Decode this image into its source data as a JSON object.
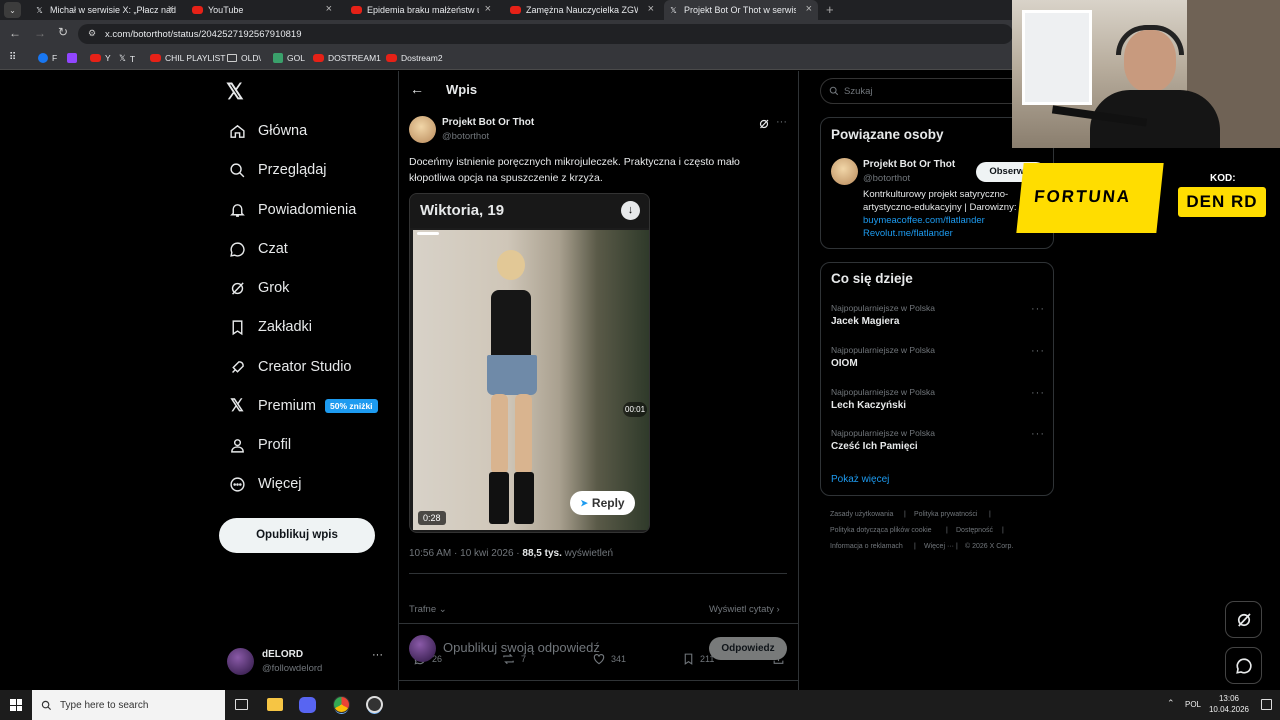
{
  "browser": {
    "tabs": [
      {
        "title": "Michał w serwisie X: „Płacz nad",
        "icon": "x-favicon-icon",
        "active": false
      },
      {
        "title": "YouTube",
        "icon": "youtube-icon",
        "active": false
      },
      {
        "title": "Epidemia braku małżeństw u m",
        "icon": "youtube-icon",
        "active": false
      },
      {
        "title": "Zamężna Nauczycielka ZGW*Ł0",
        "icon": "youtube-icon",
        "active": false
      },
      {
        "title": "Projekt Bot Or Thot w serwisie",
        "icon": "x-favicon-icon",
        "active": true
      }
    ],
    "url": "x.com/botorthot/status/2042527192567910819",
    "bookmarks": [
      "F",
      "Y",
      "T",
      "CHIL PLAYLIST",
      "OLD\\",
      "GOL",
      "DOSTREAM1",
      "Dostream2"
    ]
  },
  "sidebar": {
    "items": [
      {
        "label": "Główna",
        "icon": "home-icon"
      },
      {
        "label": "Przeglądaj",
        "icon": "search-icon"
      },
      {
        "label": "Powiadomienia",
        "icon": "bell-icon"
      },
      {
        "label": "Czat",
        "icon": "chat-icon"
      },
      {
        "label": "Grok",
        "icon": "grok-icon"
      },
      {
        "label": "Zakładki",
        "icon": "bookmark-icon"
      },
      {
        "label": "Creator Studio",
        "icon": "rocket-icon"
      },
      {
        "label": "Premium",
        "icon": "x-icon"
      },
      {
        "label": "Profil",
        "icon": "person-icon"
      },
      {
        "label": "Więcej",
        "icon": "more-circle-icon"
      }
    ],
    "premium_badge": "50% zniżki",
    "post_button": "Opublikuj wpis",
    "account": {
      "name": "dELORD",
      "handle": "@followdelord"
    }
  },
  "main": {
    "header_title": "Wpis",
    "author": {
      "name": "Projekt Bot Or Thot",
      "handle": "@botorthot"
    },
    "text_line1": "Doceńmy istnienie poręcznych mikrojuleczek. Praktyczna i często mało",
    "text_line2": "kłopotliwa opcja na spuszczenie z krzyża.",
    "media": {
      "header_name": "Wiktoria, 19",
      "video_length": "0:28",
      "video_timer": "00:01",
      "reply_label": "Reply"
    },
    "timestamp": "10:56 AM · 10 kwi 2026 · ",
    "views": "88,5 tys.",
    "views_label": "wyświetleń",
    "metrics": {
      "replies": "26",
      "reposts": "7",
      "likes": "341",
      "bookmarks": "211"
    },
    "sort_label": "Trafne",
    "quotes_link": "Wyświetl cytaty",
    "reply_placeholder": "Opublikuj swoją odpowiedź",
    "reply_button": "Odpowiedz"
  },
  "right": {
    "search_placeholder": "Szukaj",
    "related": {
      "title": "Powiązane osoby",
      "name": "Projekt Bot Or Thot",
      "handle": "@botorthot",
      "follow": "Obserwuj",
      "bio_line1": "Kontrkulturowy projekt satyryczno-",
      "bio_line2": "artystyczno-edukacyjny | Darowizny:",
      "link1": "buymeacoffee.com/flatlander",
      "link2": "Revolut.me/flatlander"
    },
    "trends": {
      "title": "Co się dzieje",
      "items": [
        {
          "context": "Najpopularniejsze w Polska",
          "name": "Jacek Magiera"
        },
        {
          "context": "Najpopularniejsze w Polska",
          "name": "OIOM"
        },
        {
          "context": "Najpopularniejsze w Polska",
          "name": "Lech Kaczyński"
        },
        {
          "context": "Najpopularniejsze w Polska",
          "name": "Cześć Ich Pamięci"
        }
      ],
      "show_more": "Pokaż więcej"
    },
    "footer": [
      "Zasady użytkowania",
      "Polityka prywatności",
      "Polityka dotycząca plików cookie",
      "Dostępność",
      "Informacja o reklamach",
      "Więcej ···",
      "© 2026 X Corp."
    ]
  },
  "overlay": {
    "sponsor": "FORTUNA",
    "code_label": "KOD:",
    "code_value": "DEN RD"
  },
  "taskbar": {
    "search_placeholder": "Type here to search",
    "language": "POL",
    "time": "13:06",
    "date": "10.04.2026"
  },
  "colors": {
    "accent": "#1d9bf0",
    "fortuna_yellow": "#ffdd00",
    "background": "#000000"
  }
}
